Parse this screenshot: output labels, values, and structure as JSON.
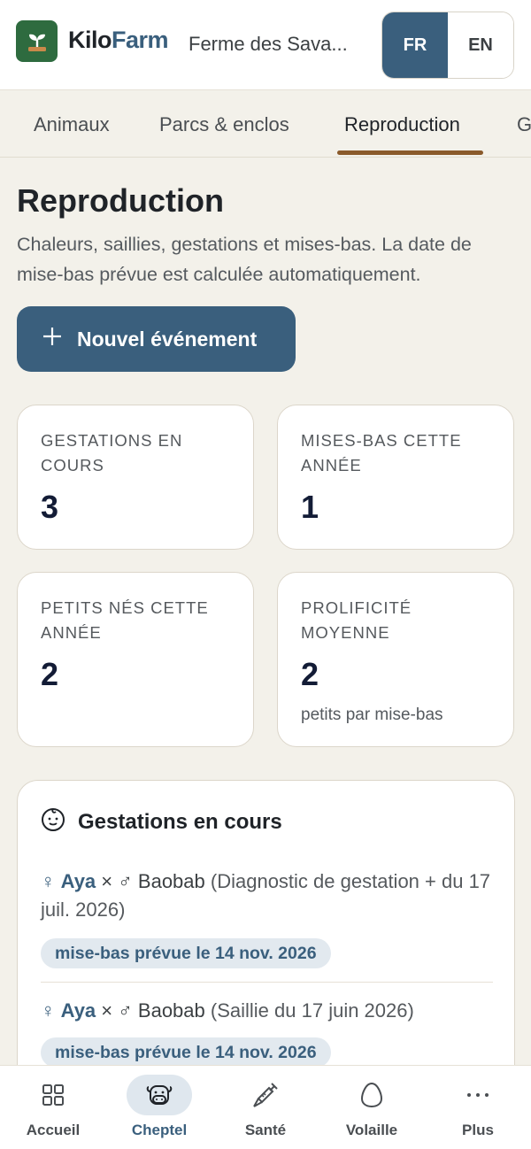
{
  "header": {
    "brand_part1": "Kilo",
    "brand_part2": "Farm",
    "farm_name": "Ferme des Sava...",
    "languages": [
      {
        "label": "FR",
        "active": true
      },
      {
        "label": "EN",
        "active": false
      }
    ]
  },
  "tabs": [
    {
      "label": "Animaux",
      "active": false
    },
    {
      "label": "Parcs & enclos",
      "active": false
    },
    {
      "label": "Reproduction",
      "active": true
    },
    {
      "label": "G",
      "active": false
    }
  ],
  "page": {
    "title": "Reproduction",
    "description": "Chaleurs, saillies, gestations et mises-bas. La date de mise-bas prévue est calculée automatiquement.",
    "new_event_button": "Nouvel événement"
  },
  "stats": [
    {
      "label": "Gestations en cours",
      "value": "3",
      "sub": ""
    },
    {
      "label": "Mises-bas cette année",
      "value": "1",
      "sub": ""
    },
    {
      "label": "Petits nés cette année",
      "value": "2",
      "sub": ""
    },
    {
      "label": "Prolificité moyenne",
      "value": "2",
      "sub": "petits par mise-bas"
    }
  ],
  "gestations": {
    "title": "Gestations en cours",
    "events": [
      {
        "female_symbol": "♀",
        "female": "Aya",
        "times": "×",
        "male_symbol": "♂",
        "male": "Baobab",
        "detail": "(Diagnostic de gestation + du 17 juil. 2026)",
        "due": "mise-bas prévue le 14 nov. 2026"
      },
      {
        "female_symbol": "♀",
        "female": "Aya",
        "times": "×",
        "male_symbol": "♂",
        "male": "Baobab",
        "detail": "(Saillie du 17 juin 2026)",
        "due": "mise-bas prévue le 14 nov. 2026"
      }
    ]
  },
  "bottom_nav": [
    {
      "label": "Accueil",
      "icon": "grid-icon",
      "active": false
    },
    {
      "label": "Cheptel",
      "icon": "cow-icon",
      "active": true
    },
    {
      "label": "Santé",
      "icon": "syringe-icon",
      "active": false
    },
    {
      "label": "Volaille",
      "icon": "egg-icon",
      "active": false
    },
    {
      "label": "Plus",
      "icon": "more-icon",
      "active": false
    }
  ],
  "colors": {
    "primary": "#3a5f7d",
    "brand_green": "#2e6b3f",
    "tab_underline": "#8a5a2b",
    "background": "#f3f1ea"
  }
}
